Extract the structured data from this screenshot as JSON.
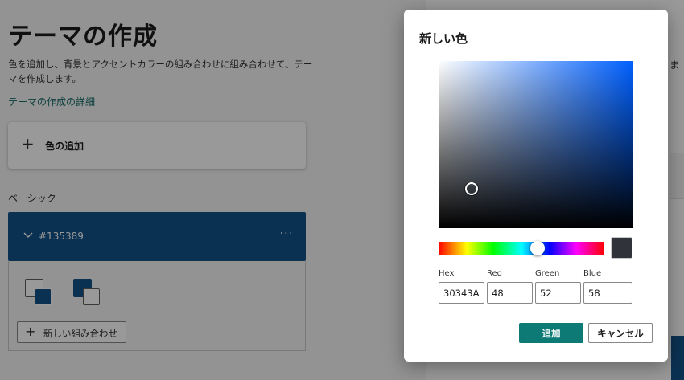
{
  "page": {
    "title": "テーマの作成",
    "description": "色を追加し、背景とアクセントカラーの組み合わせに組み合わせて、テーマを作成します。",
    "learn_more_link": "テーマの作成の詳細",
    "add_color_label": "色の追加",
    "basic_section_label": "ベーシック",
    "basic_color": {
      "hex_label": "#135389",
      "more_icon": "more-horizontal-icon",
      "color": "#135389"
    },
    "combinations": [
      {
        "background": "#ffffff",
        "accent": "#135389"
      },
      {
        "background": "#135389",
        "accent": "#ffffff"
      }
    ],
    "new_combination_label": "新しい組み合わせ",
    "right_panel_partial_text": "ま"
  },
  "dialog": {
    "title": "新しい色",
    "hue_color": "#0060ff",
    "selected_color": "#30343A",
    "fields": {
      "hex": {
        "label": "Hex",
        "value": "30343A"
      },
      "red": {
        "label": "Red",
        "value": "48"
      },
      "green": {
        "label": "Green",
        "value": "52"
      },
      "blue": {
        "label": "Blue",
        "value": "58"
      }
    },
    "primary_button": "追加",
    "secondary_button": "キャンセル",
    "accent_color": "#0d7a76"
  }
}
